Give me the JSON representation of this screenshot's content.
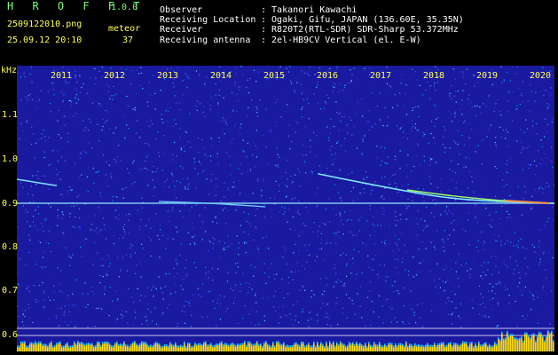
{
  "header": {
    "app_title": "H R O F F T",
    "version": "1.0.0",
    "file_name": "2509122010.png",
    "timestamp": "25.09.12 20:10",
    "meteor_label": "meteor",
    "meteor_count": "37"
  },
  "info": [
    {
      "key": "Observer",
      "value": ": Takanori Kawachi"
    },
    {
      "key": "Receiving Location",
      "value": ": Ogaki, Gifu, JAPAN (136.60E, 35.35N)"
    },
    {
      "key": "Receiver",
      "value": ": R820T2(RTL-SDR) SDR-Sharp 53.372MHz"
    },
    {
      "key": "Receiving antenna",
      "value": ": 2el-HB9CV Vertical (el. E-W)"
    }
  ],
  "axes": {
    "y_unit": "kHz",
    "y_ticks": [
      "1.1",
      "1.0",
      "0.9",
      "0.8",
      "0.7",
      "0.6"
    ],
    "x_ticks": [
      "2011",
      "2012",
      "2013",
      "2014",
      "2015",
      "2016",
      "2017",
      "2018",
      "2019",
      "2020"
    ]
  },
  "colors": {
    "background": "#1a1aa0",
    "text_green": "#7CFC7C",
    "text_yellow": "#ffff55",
    "signal": "#ffffff"
  }
}
